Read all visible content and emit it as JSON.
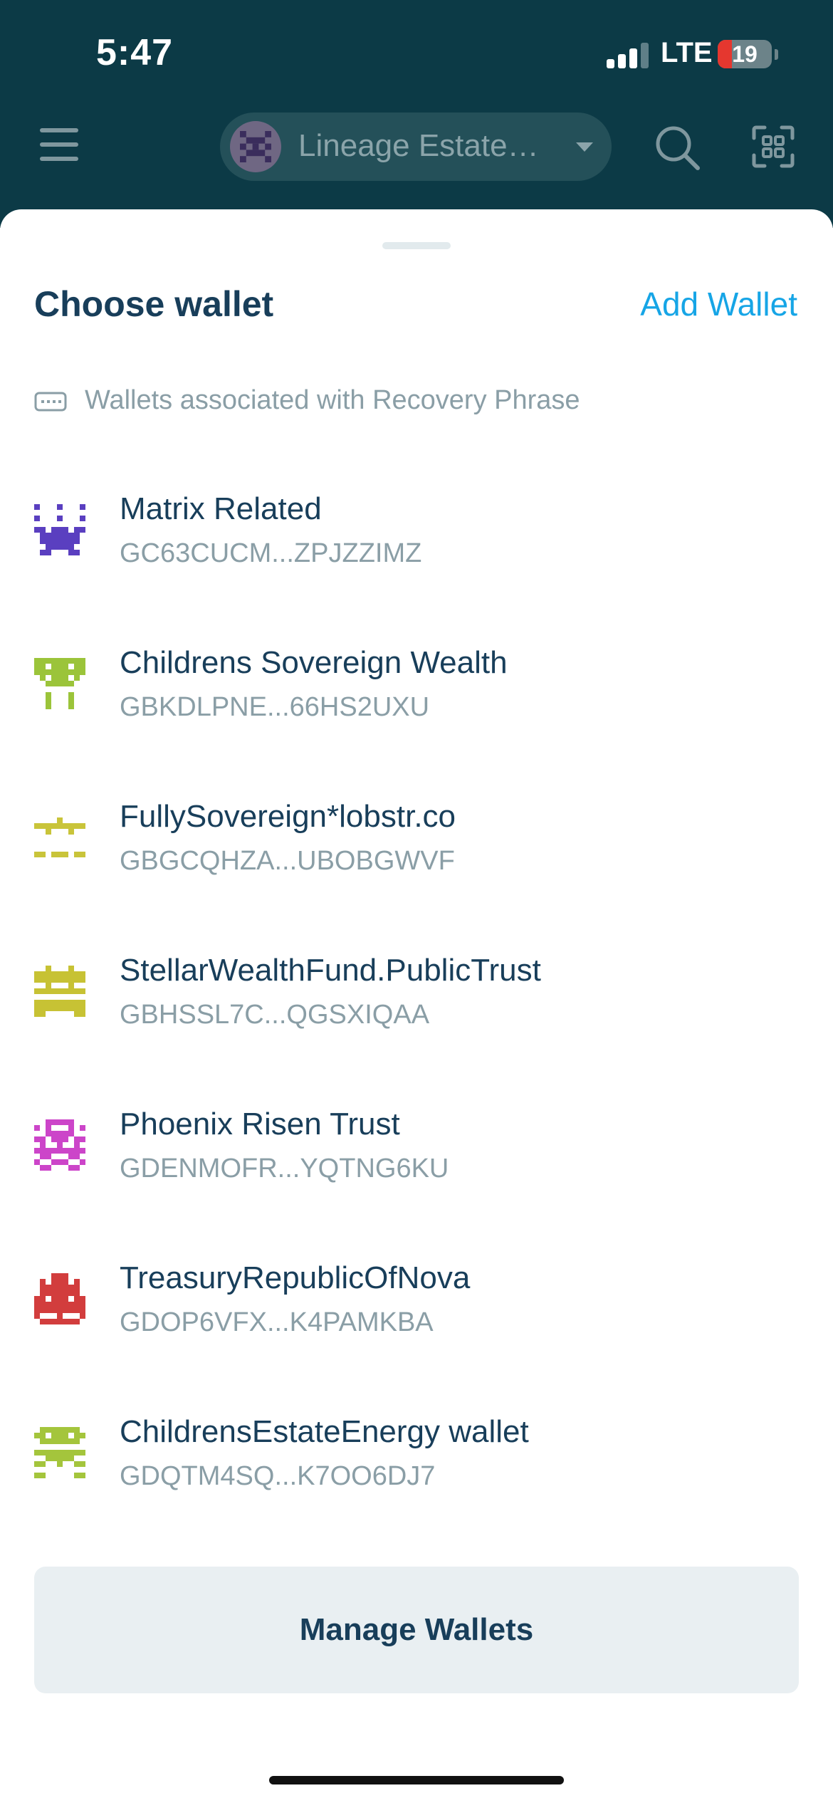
{
  "status_bar": {
    "time": "5:47",
    "network": "LTE",
    "battery": "19"
  },
  "header": {
    "current_wallet": "Lineage Estate…",
    "icons": [
      "menu-icon",
      "avatar-icon",
      "chevron-down-icon",
      "search-icon",
      "qr-scan-icon"
    ]
  },
  "sheet": {
    "title": "Choose wallet",
    "add_wallet_label": "Add Wallet",
    "section_label": "Wallets associated with Recovery Phrase",
    "section_icon": "keyboard-icon",
    "wallets": [
      {
        "name": "Matrix Related",
        "address": "GC63CUCM...ZPJZZIMZ",
        "color": "#5a3fc0"
      },
      {
        "name": "Childrens Sovereign Wealth",
        "address": "GBKDLPNE...66HS2UXU",
        "color": "#9bc43a"
      },
      {
        "name": "FullySovereign*lobstr.co",
        "address": "GBGCQHZA...UBOBGWVF",
        "color": "#c9c43a"
      },
      {
        "name": "StellarWealthFund.PublicTrust",
        "address": "GBHSSL7C...QGSXIQAA",
        "color": "#c7c234"
      },
      {
        "name": "Phoenix Risen Trust",
        "address": "GDENMOFR...YQTNG6KU",
        "color": "#cc45c9"
      },
      {
        "name": "TreasuryRepublicOfNova",
        "address": "GDOP6VFX...K4PAMKBA",
        "color": "#d23d3d"
      },
      {
        "name": "ChildrensEstateEnergy wallet",
        "address": "GDQTM4SQ...K7OO6DJ7",
        "color": "#a4c53c"
      }
    ],
    "manage_label": "Manage Wallets"
  },
  "colors": {
    "header_bg": "#0c3a46",
    "accent": "#16a5e6",
    "text_primary": "#183e5a",
    "text_secondary": "#8a9ea6",
    "button_bg": "#e9eff2"
  }
}
